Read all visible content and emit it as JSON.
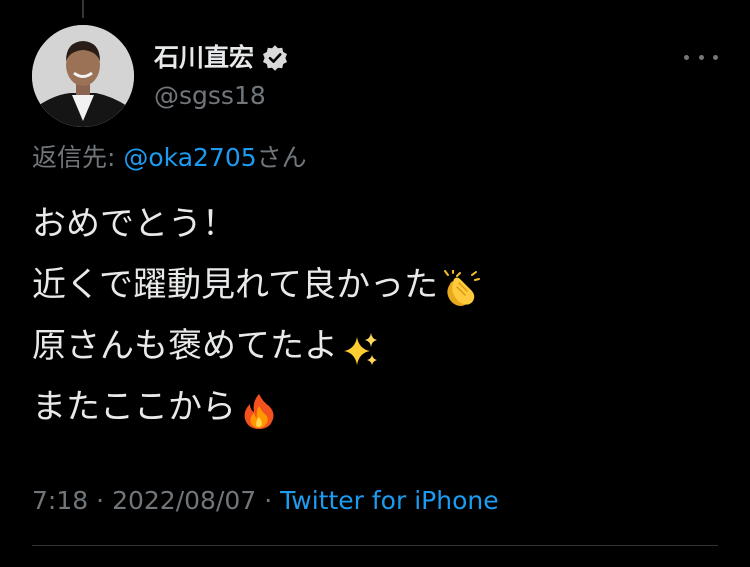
{
  "tweet": {
    "author": {
      "display_name": "石川直宏",
      "handle": "@sgss18",
      "verified": true
    },
    "reply_to": {
      "prefix": "返信先: ",
      "mention": "@oka2705",
      "suffix": "さん"
    },
    "lines": [
      {
        "text": "おめでとう！",
        "emoji": ""
      },
      {
        "text": "近くで躍動見れて良かった",
        "emoji": "clapping-hands"
      },
      {
        "text": "原さんも褒めてたよ",
        "emoji": "sparkles"
      },
      {
        "text": "またここから",
        "emoji": "fire"
      }
    ],
    "meta": {
      "time": "7:18",
      "separator": "·",
      "date": "2022/08/07",
      "source": "Twitter for iPhone"
    }
  },
  "icons": {
    "verified": "verified-badge-icon",
    "more": "more-options-icon"
  },
  "colors": {
    "background": "#000000",
    "text": "#e7e9ea",
    "secondary": "#71767b",
    "link": "#1d9bf0",
    "divider": "#2f3336"
  }
}
